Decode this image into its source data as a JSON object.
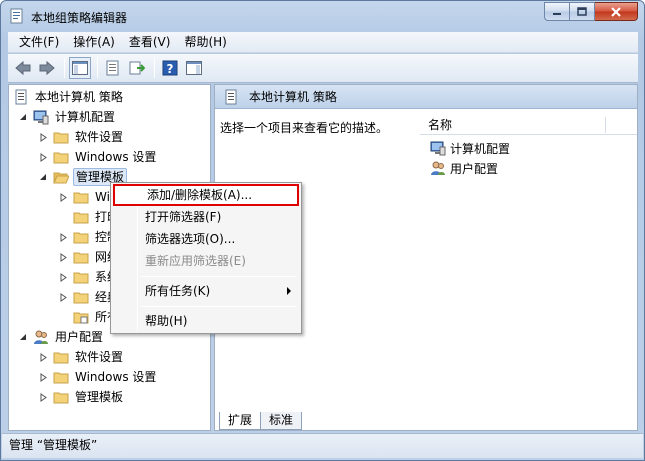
{
  "window": {
    "title": "本地组策略编辑器"
  },
  "menubar": {
    "items": [
      "文件(F)",
      "操作(A)",
      "查看(V)",
      "帮助(H)"
    ]
  },
  "toolbar": {
    "icons": [
      "back-arrow-icon",
      "forward-arrow-icon",
      "show-hide-tree-icon",
      "properties-icon",
      "export-list-icon",
      "help-icon",
      "show-hide-action-pane-icon"
    ]
  },
  "tree": {
    "root": "本地计算机 策略",
    "computer_config": "计算机配置",
    "software_settings": "软件设置",
    "windows_settings": "Windows 设置",
    "admin_templates": "管理模板",
    "sub_wi": "Wi",
    "sub_print": "打印",
    "sub_control": "控制",
    "sub_network": "网络",
    "sub_system": "系统",
    "sub_classic": "经典",
    "sub_all": "所有",
    "user_config": "用户配置",
    "user_software_settings": "软件设置",
    "user_windows_settings": "Windows 设置",
    "user_admin_templates": "管理模板"
  },
  "right_pane": {
    "header": "本地计算机 策略",
    "description": "选择一个项目来查看它的描述。",
    "column_name": "名称",
    "items": [
      "计算机配置",
      "用户配置"
    ],
    "tabs": [
      "扩展",
      "标准"
    ]
  },
  "context_menu": {
    "items": [
      "添加/删除模板(A)...",
      "打开筛选器(F)",
      "筛选器选项(O)...",
      "重新应用筛选器(E)",
      "所有任务(K)",
      "帮助(H)"
    ]
  },
  "statusbar": {
    "text": "管理 “管理模板”"
  },
  "colors": {
    "highlight_border": "#e00000",
    "folder": "#f3d27a"
  }
}
